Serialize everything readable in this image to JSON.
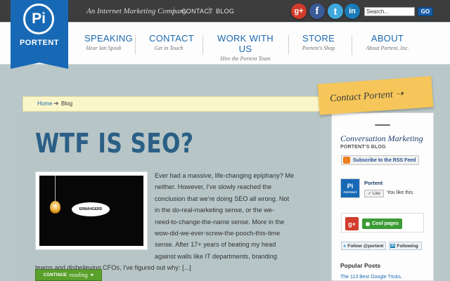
{
  "topbar": {
    "tagline": "An Internet Marketing Company",
    "contact_label": "CONTACT",
    "blog_label": "BLOG",
    "separator": "|",
    "search_value": "Search...",
    "go_label": "GO"
  },
  "social": {
    "gplus": "g+",
    "facebook": "f",
    "twitter": "t",
    "linkedin": "in"
  },
  "logo": {
    "mark": "Pi",
    "name": "PORTENT"
  },
  "nav": [
    {
      "title": "SPEAKING",
      "sub": "Hear Ian Speak"
    },
    {
      "title": "CONTACT",
      "sub": "Get in Touch"
    },
    {
      "title": "WORK WITH US",
      "sub": "Hire the Portent Team"
    },
    {
      "title": "STORE",
      "sub": "Portent's Shop"
    },
    {
      "title": "ABOUT",
      "sub": "About Portent, Inc."
    }
  ],
  "breadcrumb": {
    "home": "Home",
    "arrow": "➔",
    "current": "Blog"
  },
  "post": {
    "title": "WTF IS SEO?",
    "image_caption": "ERMAHGERD",
    "lines": [
      "Ever had a massive, life-changing epiphany? Me",
      "neither. However, I've slowly reached the",
      "conclusion that we're doing SEO all wrong. Not",
      "in the do-real-marketing sense, or the we-",
      "need-to-change-the-name sense. More in the",
      "wow-did-we-ever-screw-the-pooch-this-time",
      "sense. After 17+ years of beating my head",
      "against walls like IT departments, branding",
      "teams and disbelieving CFOs, I've figured out why: [...]"
    ],
    "continue_label": "CONTINUE",
    "continue_em": "reading",
    "continue_arrow": "➔"
  },
  "sidebar": {
    "contact_note": "Contact Portent ➝",
    "title": "Conversation Marketing",
    "subtitle": "PORTENT'S BLOG",
    "rss_label": "Subscribe to the RSS Feed",
    "fb_avatar_mark": "Pi",
    "fb_avatar_label": "PORTENT",
    "fb_name": "Portent",
    "like_label": "✓ Like",
    "like_text": "You like this.",
    "gplus_label": "g+",
    "cool_label": "Cool pages",
    "twitter_follow": "Follow @portent",
    "linkedin_mark": "in",
    "linkedin_follow": "Following",
    "popular_heading": "Popular Posts",
    "popular_link": "The 113 Best Google Tricks,"
  }
}
